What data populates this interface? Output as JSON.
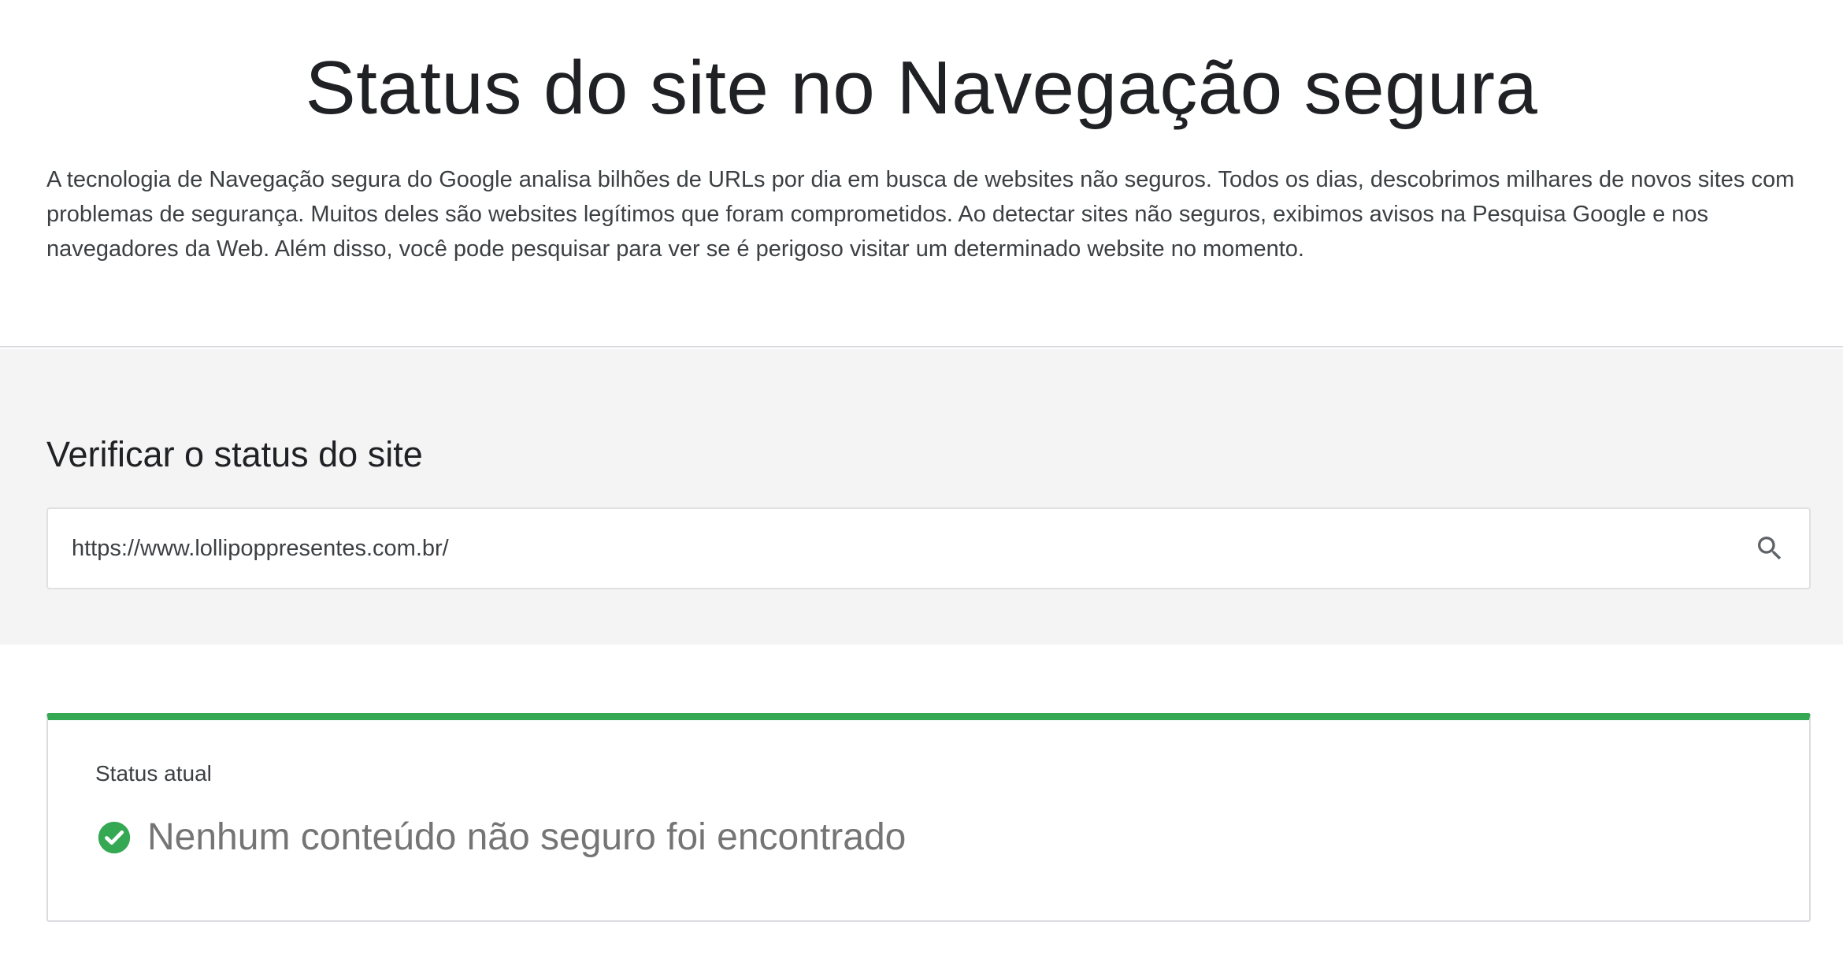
{
  "header": {
    "title": "Status do site no Navegação segura",
    "intro": "A tecnologia de Navegação segura do Google analisa bilhões de URLs por dia em busca de websites não seguros. Todos os dias, descobrimos milhares de novos sites com problemas de segurança. Muitos deles são websites legítimos que foram comprometidos. Ao detectar sites não seguros, exibimos avisos na Pesquisa Google e nos navegadores da Web. Além disso, você pode pesquisar para ver se é perigoso visitar um determinado website no momento."
  },
  "check": {
    "heading": "Verificar o status do site",
    "input_value": "https://www.lollipoppresentes.com.br/",
    "search_icon": "search-icon"
  },
  "result": {
    "label": "Status atual",
    "status_icon": "check-circle-icon",
    "status_text": "Nenhum conteúdo não seguro foi encontrado",
    "accent_color": "#34a853"
  }
}
